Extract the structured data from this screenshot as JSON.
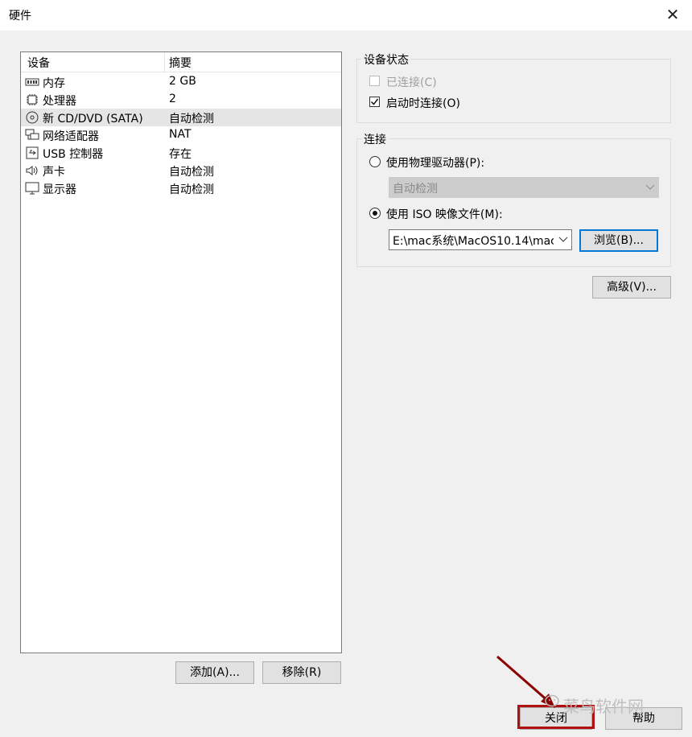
{
  "window": {
    "title": "硬件",
    "close_glyph": "✕"
  },
  "device_list": {
    "columns": [
      "设备",
      "摘要"
    ],
    "rows": [
      {
        "icon": "memory-icon",
        "name": "内存",
        "summary": "2 GB",
        "selected": false
      },
      {
        "icon": "processor-icon",
        "name": "处理器",
        "summary": "2",
        "selected": false
      },
      {
        "icon": "cd-dvd-icon",
        "name": "新 CD/DVD (SATA)",
        "summary": "自动检测",
        "selected": true
      },
      {
        "icon": "network-adapter-icon",
        "name": "网络适配器",
        "summary": "NAT",
        "selected": false
      },
      {
        "icon": "usb-icon",
        "name": "USB 控制器",
        "summary": "存在",
        "selected": false
      },
      {
        "icon": "sound-card-icon",
        "name": "声卡",
        "summary": "自动检测",
        "selected": false
      },
      {
        "icon": "display-icon",
        "name": "显示器",
        "summary": "自动检测",
        "selected": false
      }
    ]
  },
  "list_buttons": {
    "add": "添加(A)...",
    "remove": "移除(R)"
  },
  "device_status": {
    "title": "设备状态",
    "connected": {
      "label": "已连接(C)",
      "checked": false,
      "disabled": true
    },
    "connect_at_power_on": {
      "label": "启动时连接(O)",
      "checked": true
    }
  },
  "connection": {
    "title": "连接",
    "physical_drive": {
      "label": "使用物理驱动器(P):",
      "selected": false,
      "value": "自动检测"
    },
    "iso_image": {
      "label": "使用 ISO 映像文件(M):",
      "selected": true,
      "value": "E:\\mac系统\\MacOS10.14\\mac"
    },
    "browse_button": "浏览(B)..."
  },
  "advanced_button": "高级(V)...",
  "footer": {
    "close_button": "关闭",
    "help_button": "帮助"
  },
  "watermark": "菜鸟软件网",
  "colors": {
    "highlight_border": "#b01010",
    "focus_border": "#0078d7",
    "selected_row": "#e5e5e5"
  }
}
